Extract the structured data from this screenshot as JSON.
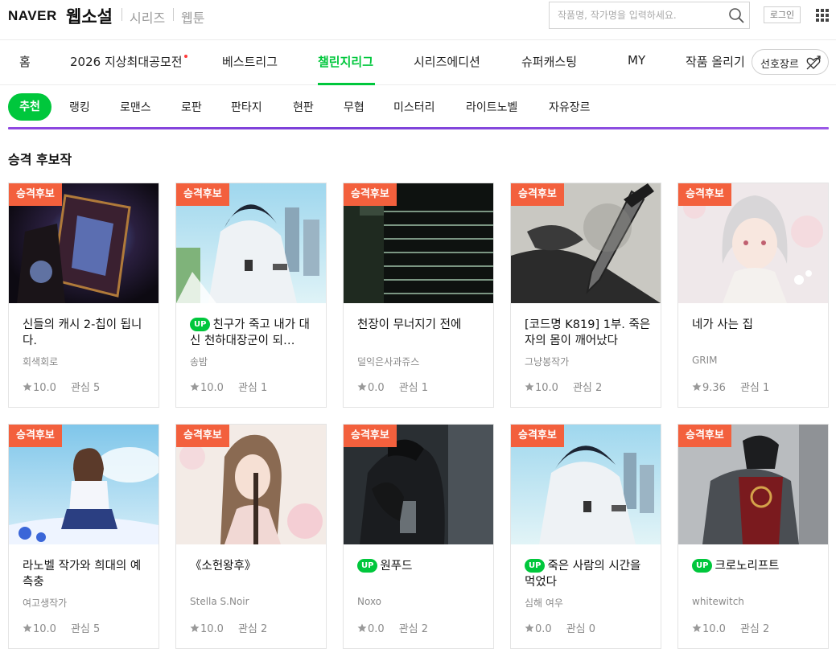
{
  "header": {
    "logo": "NAVER",
    "service_name": "웹소설",
    "links": [
      "시리즈",
      "웹툰"
    ],
    "search_placeholder": "작품명, 작가명을 입력하세요.",
    "login_label": "로그인"
  },
  "main_nav": {
    "items": [
      "홈",
      "2026 지상최대공모전",
      "베스트리그",
      "챌린지리그",
      "시리즈에디션",
      "슈퍼캐스팅",
      "MY",
      "작품 올리기"
    ],
    "active": "챌린지리그",
    "preferred_genre_label": "선호장르"
  },
  "genre_tabs": {
    "active": "추천",
    "items": [
      "랭킹",
      "로맨스",
      "로판",
      "판타지",
      "현판",
      "무협",
      "미스터리",
      "라이트노벨",
      "자유장르"
    ]
  },
  "section": {
    "title": "승격 후보작",
    "cards": [
      {
        "badge": "승격후보",
        "up": false,
        "title": "신들의 캐시 2-칩이 됩니다.",
        "author": "회색회로",
        "rating": "10.0",
        "interest_label": "관심",
        "interest": "5"
      },
      {
        "badge": "승격후보",
        "up": true,
        "up_label": "UP",
        "title": "친구가 죽고 내가 대신 천하대장군이 되…",
        "author": "송밤",
        "rating": "10.0",
        "interest_label": "관심",
        "interest": "1"
      },
      {
        "badge": "승격후보",
        "up": false,
        "title": "천장이 무너지기 전에",
        "author": "덜익은사과쥬스",
        "rating": "0.0",
        "interest_label": "관심",
        "interest": "1"
      },
      {
        "badge": "승격후보",
        "up": false,
        "title": "[코드명 K819] 1부. 죽은 자의 몸이 깨어났다",
        "author": "그냥봉작가",
        "rating": "10.0",
        "interest_label": "관심",
        "interest": "2"
      },
      {
        "badge": "승격후보",
        "up": false,
        "title": "네가 사는 집",
        "author": "GRIM",
        "rating": "9.36",
        "interest_label": "관심",
        "interest": "1"
      },
      {
        "badge": "승격후보",
        "up": false,
        "title": "라노벨 작가와 희대의 예측충",
        "author": "여고생작가",
        "rating": "10.0",
        "interest_label": "관심",
        "interest": "5"
      },
      {
        "badge": "승격후보",
        "up": false,
        "title": "《소헌왕후》",
        "author": "Stella S.Noir",
        "rating": "10.0",
        "interest_label": "관심",
        "interest": "2"
      },
      {
        "badge": "승격후보",
        "up": true,
        "up_label": "UP",
        "title": "원푸드",
        "author": "Noxo",
        "rating": "0.0",
        "interest_label": "관심",
        "interest": "2"
      },
      {
        "badge": "승격후보",
        "up": true,
        "up_label": "UP",
        "title": "죽은 사람의 시간을 먹었다",
        "author": "심해 여우",
        "rating": "0.0",
        "interest_label": "관심",
        "interest": "0"
      },
      {
        "badge": "승격후보",
        "up": true,
        "up_label": "UP",
        "title": "크로노리프트",
        "author": "whitewitch",
        "rating": "10.0",
        "interest_label": "관심",
        "interest": "2"
      }
    ]
  },
  "colors": {
    "brand_green": "#00c73c",
    "badge_orange": "#f3603d",
    "purple_divider": "#8f47e0",
    "nav_dot_red": "#ff3b3b"
  },
  "icons": [
    "search-icon",
    "apps-grid-icon",
    "heart-arrow-icon",
    "star-icon"
  ]
}
